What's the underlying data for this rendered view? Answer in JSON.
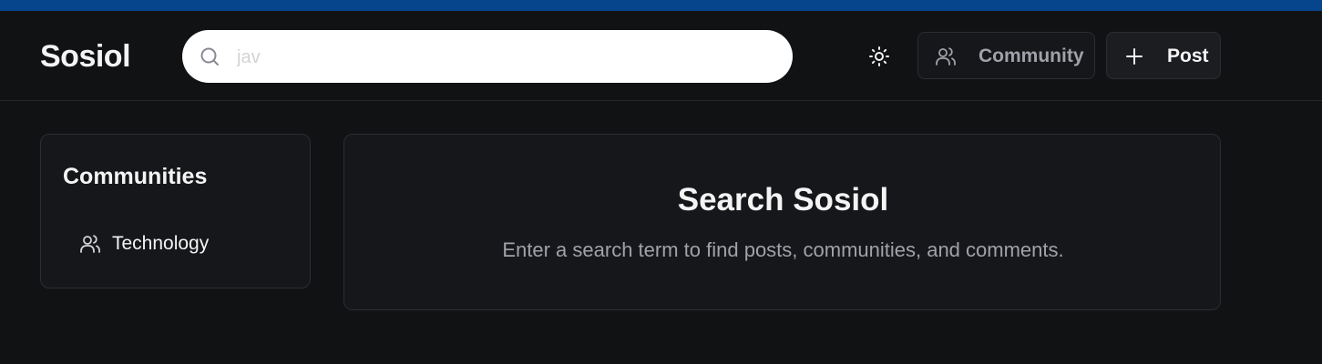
{
  "header": {
    "logo": "Sosiol",
    "search": {
      "value": "",
      "placeholder": "jav"
    },
    "theme_toggle_icon": "sun-icon",
    "community_button": {
      "label": "Community",
      "icon": "users-icon"
    },
    "post_button": {
      "label": "Post",
      "icon": "plus-icon"
    }
  },
  "sidebar": {
    "title": "Communities",
    "items": [
      {
        "label": "Technology",
        "icon": "users-icon"
      }
    ]
  },
  "main": {
    "title": "Search Sosiol",
    "subtitle": "Enter a search term to find posts, communities, and comments."
  },
  "colors": {
    "top_strip": "#06458c",
    "background": "#111214",
    "card": "#16171a",
    "border": "#2c2d33",
    "muted_text": "#a1a1aa"
  }
}
